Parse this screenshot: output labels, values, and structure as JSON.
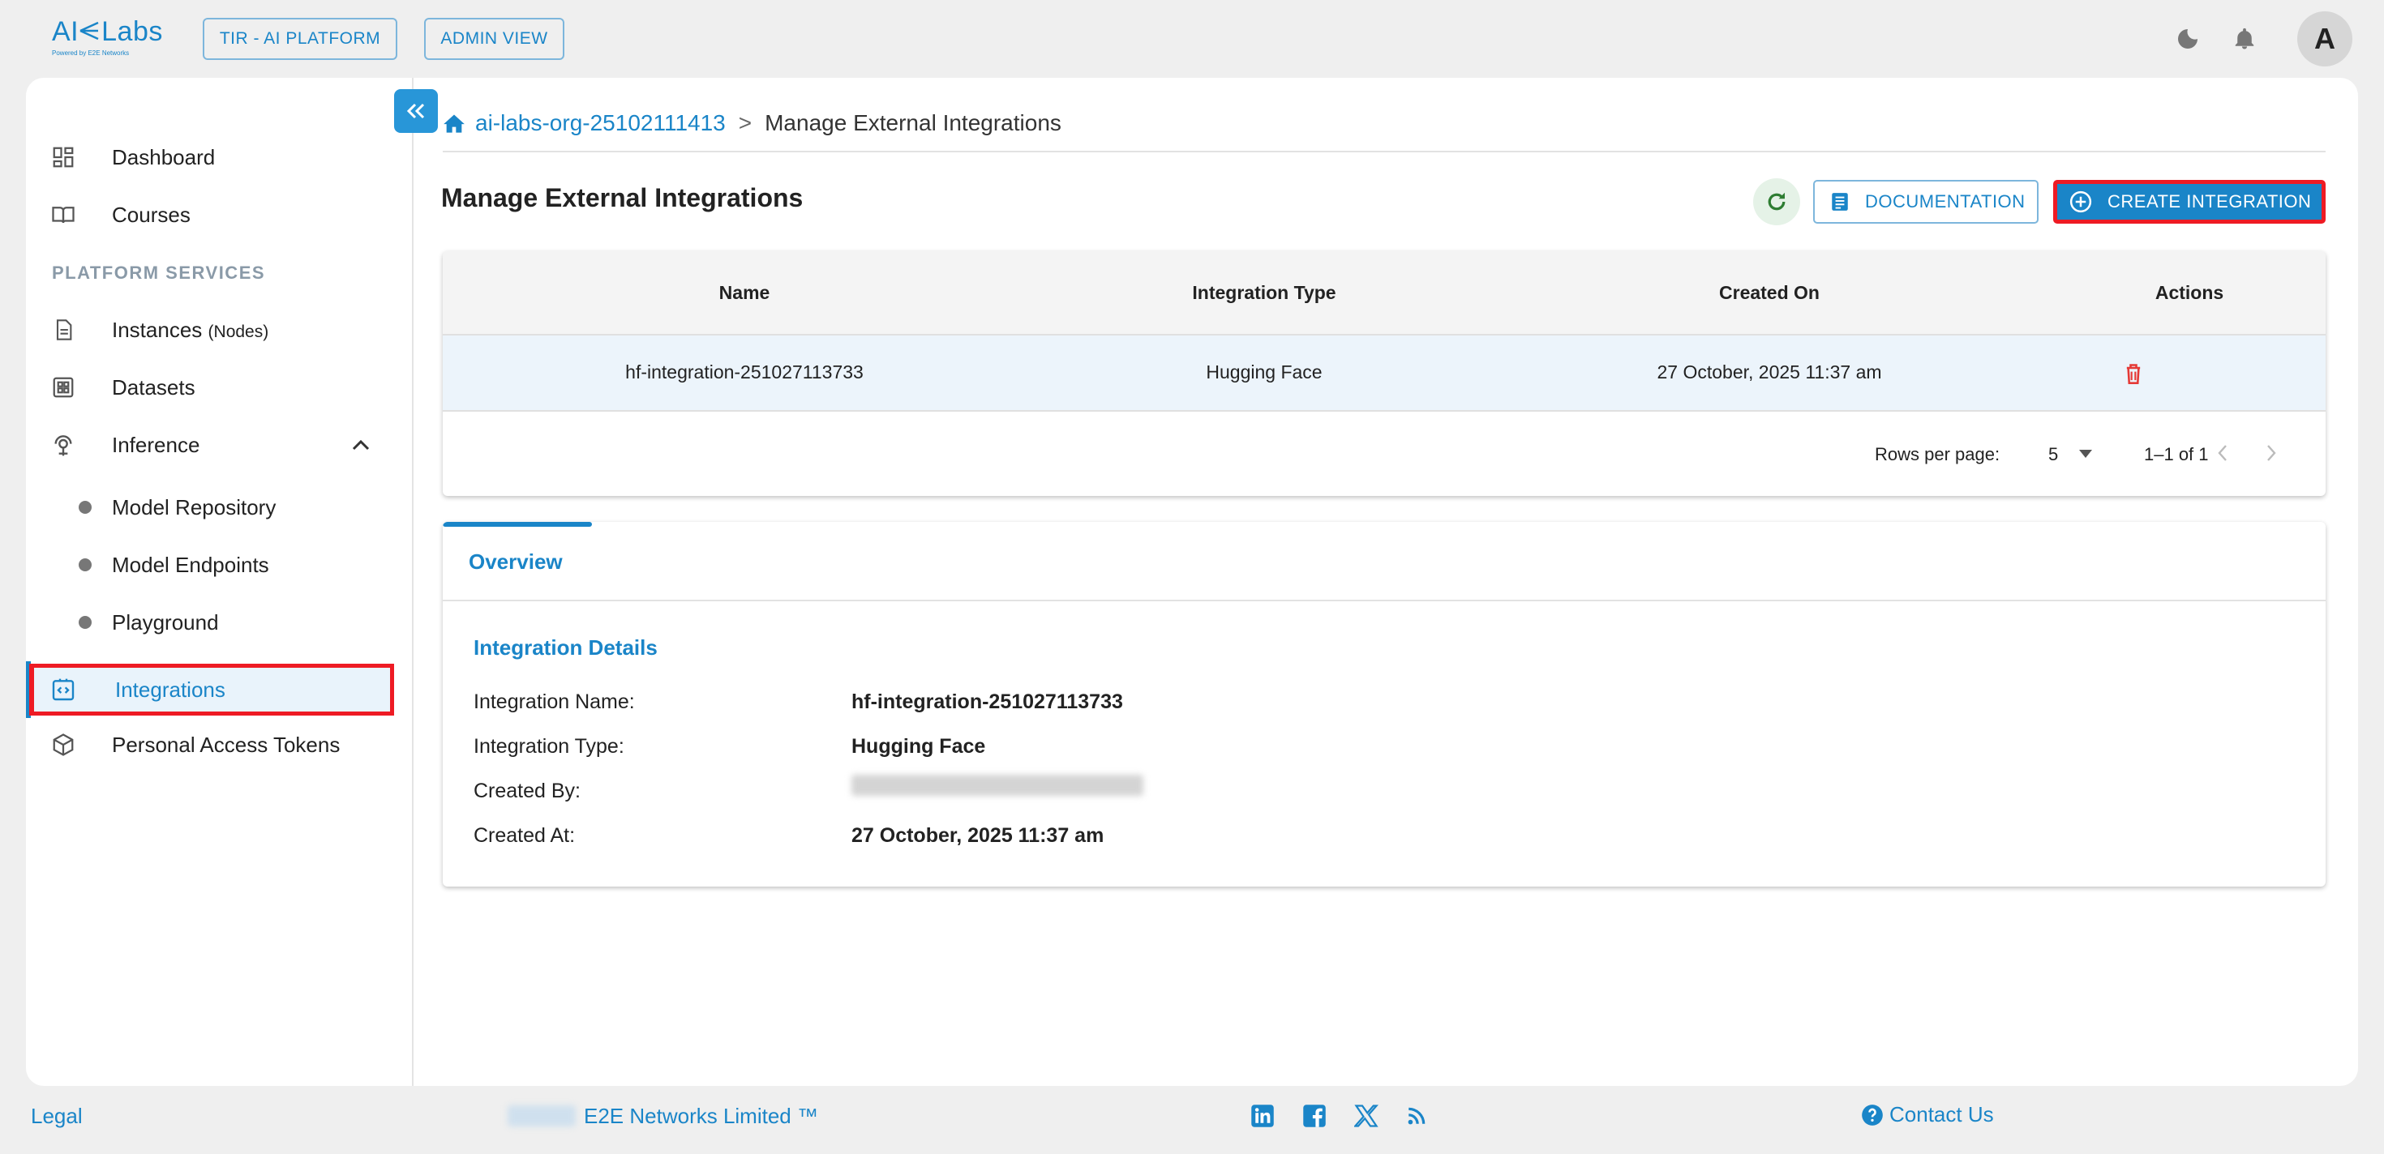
{
  "brand": {
    "logo_text_left": "AI",
    "logo_text_right": "Labs",
    "logo_subtitle": "Powered by E2E Networks"
  },
  "topbar": {
    "tir_button": "TIR - AI PLATFORM",
    "admin_button": "ADMIN VIEW",
    "avatar_initial": "A"
  },
  "sidebar": {
    "dashboard": "Dashboard",
    "courses": "Courses",
    "section_label": "PLATFORM SERVICES",
    "instances": "Instances",
    "instances_suffix": "(Nodes)",
    "datasets": "Datasets",
    "inference": "Inference",
    "model_repository": "Model Repository",
    "model_endpoints": "Model Endpoints",
    "playground": "Playground",
    "integrations": "Integrations",
    "personal_access_tokens": "Personal Access Tokens"
  },
  "breadcrumb": {
    "org": "ai-labs-org-25102111413",
    "separator": ">",
    "current": "Manage External Integrations"
  },
  "page": {
    "title": "Manage External Integrations",
    "documentation_button": "DOCUMENTATION",
    "create_button": "CREATE INTEGRATION"
  },
  "table": {
    "headers": [
      "Name",
      "Integration Type",
      "Created On",
      "Actions"
    ],
    "rows": [
      {
        "name": "hf-integration-251027113733",
        "type": "Hugging Face",
        "created_on": "27 October, 2025 11:37 am"
      }
    ],
    "rows_per_page_label": "Rows per page:",
    "rows_per_page_value": "5",
    "range_label": "1–1 of 1"
  },
  "details": {
    "tab": "Overview",
    "title": "Integration Details",
    "labels": {
      "name": "Integration Name:",
      "type": "Integration Type:",
      "created_by": "Created By:",
      "created_at": "Created At:"
    },
    "values": {
      "name": "hf-integration-251027113733",
      "type": "Hugging Face",
      "created_at": "27 October, 2025 11:37 am"
    }
  },
  "footer": {
    "legal": "Legal",
    "company": "E2E Networks Limited ™",
    "contact": "Contact Us"
  },
  "colors": {
    "accent": "#1a85c8",
    "highlight_border": "#ee1b24",
    "delete_icon": "#e53935",
    "refresh_icon": "#2e7d32"
  }
}
